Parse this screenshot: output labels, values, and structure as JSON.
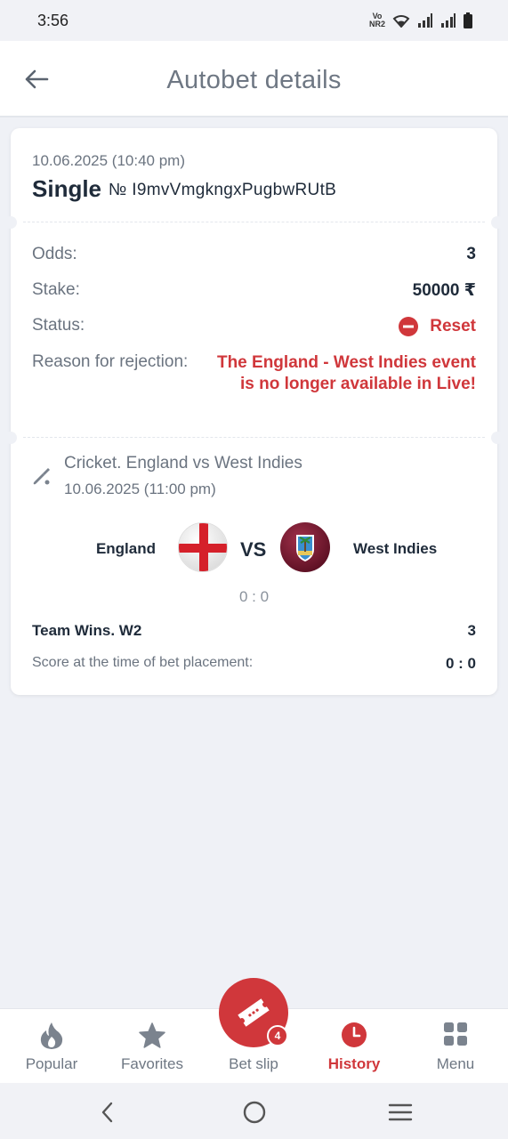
{
  "status_bar": {
    "time": "3:56",
    "network_label_top": "Vo",
    "network_label_bottom": "NR2"
  },
  "header": {
    "title": "Autobet details",
    "back_icon": "arrow-left-icon"
  },
  "bet": {
    "date": "10.06.2025 (10:40 pm)",
    "type": "Single",
    "number": "№ I9mvVmgkngxPugbwRUtB",
    "odds_label": "Odds:",
    "odds_value": "3",
    "stake_label": "Stake:",
    "stake_value": "50000 ₹",
    "status_label": "Status:",
    "status_value": "Reset",
    "status_icon": "minus-circle-icon",
    "reason_label": "Reason for rejection:",
    "reason_value": "The England - West Indies event is no longer available in Live!"
  },
  "event": {
    "sport_icon": "cricket-bat-icon",
    "name": "Cricket. England vs West Indies",
    "date": "10.06.2025 (11:00 pm)",
    "team1": "England",
    "team2": "West Indies",
    "vs": "VS",
    "score": "0 : 0",
    "market": "Team Wins. W2",
    "market_odds": "3",
    "score_label": "Score at the time of bet placement:",
    "score_value": "0 : 0"
  },
  "bottom_nav": {
    "items": [
      {
        "label": "Popular",
        "icon": "flame-icon"
      },
      {
        "label": "Favorites",
        "icon": "star-icon"
      },
      {
        "label": "Bet slip",
        "icon": "ticket-icon"
      },
      {
        "label": "History",
        "icon": "clock-icon"
      },
      {
        "label": "Menu",
        "icon": "grid-icon"
      }
    ],
    "active": "History",
    "betslip_count": "4"
  },
  "colors": {
    "accent": "#d0373b",
    "text_dark": "#1f2b3a",
    "text_muted": "#6b7480",
    "background": "#eff1f6"
  }
}
